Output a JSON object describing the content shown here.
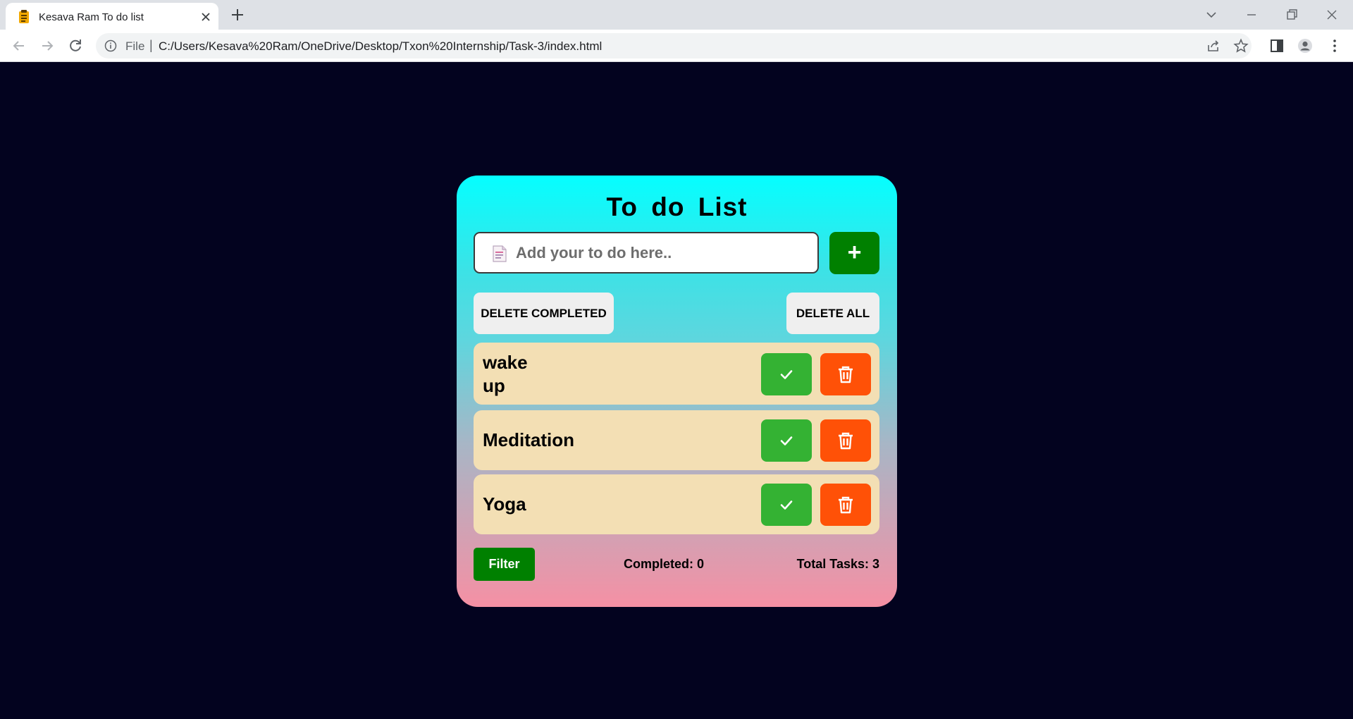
{
  "browser": {
    "tab_title": "Kesava Ram To do list",
    "scheme_label": "File",
    "url": "C:/Users/Kesava%20Ram/OneDrive/Desktop/Txon%20Internship/Task-3/index.html"
  },
  "app": {
    "title": "To do List",
    "input_placeholder": "Add your to do here..",
    "add_label": "+",
    "delete_completed_label": "DELETE COMPLETED",
    "delete_all_label": "DELETE ALL",
    "tasks": [
      {
        "text": "wake up"
      },
      {
        "text": "Meditation"
      },
      {
        "text": "Yoga"
      }
    ],
    "filter_label": "Filter",
    "completed_text": "Completed: 0",
    "total_text": "Total Tasks: 3"
  },
  "colors": {
    "page_bg": "#03031f",
    "accent_green": "#008000",
    "complete_green": "#34b233",
    "delete_orange": "#ff5107",
    "task_bg": "#f3dfb4",
    "gradient_top": "#05ffff",
    "gradient_bottom": "#f590a4"
  },
  "icons": {
    "favicon": "clipboard-icon",
    "input": "note-icon",
    "complete": "check-icon",
    "delete": "trash-icon"
  }
}
